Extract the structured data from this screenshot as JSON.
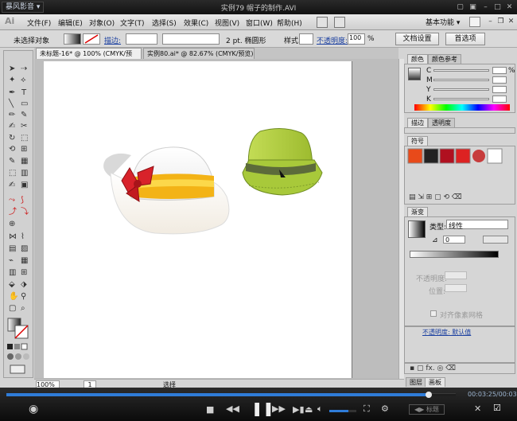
{
  "player": {
    "badge": "暴风影音",
    "window_title": "实例79 帽子的制作.AVI",
    "time": "00:03:25/00:03:38",
    "progress_fraction": 0.94,
    "volume_fraction": 0.7,
    "subtitle_label": "标题"
  },
  "ai": {
    "logo": "Ai",
    "menus": [
      "文件(F)",
      "编辑(E)",
      "对象(O)",
      "文字(T)",
      "选择(S)",
      "效果(C)",
      "视图(V)",
      "窗口(W)",
      "帮助(H)"
    ],
    "workspace": "基本功能"
  },
  "control": {
    "selection_label": "未选择对象",
    "stroke_label": "描边:",
    "brush_size": "2 pt. 椭圆形",
    "style_label": "样式:",
    "opacity_label": "不透明度:",
    "opacity_value": "100",
    "opacity_unit": "%",
    "doc_settings": "文档设置",
    "preferences": "首选项"
  },
  "tabs": [
    {
      "label": "未标题-16* @ 100% (CMYK/预览)"
    },
    {
      "label": "实例80.ai* @ 82.67% (CMYK/预览)"
    }
  ],
  "status": {
    "zoom": "100%",
    "page": "1",
    "mode": "选择"
  },
  "panels": {
    "color_tab": "颜色",
    "color_guide_tab": "颜色参考",
    "cmyk": [
      "C",
      "M",
      "Y",
      "K"
    ],
    "percent": "%",
    "stroke_tab": "描边",
    "transparency_tab": "透明度",
    "symbols_tab": "符号",
    "gradient_tab": "渐变",
    "type_label": "类型:",
    "type_value": "线性",
    "angle_value": "0",
    "opacity_label": "不透明度:",
    "location_label": "位置:",
    "align_pixel": "对齐像素网格",
    "appearance_row": "不透明度: 默认值",
    "layers_tab": "图层",
    "artboards_tab": "画板"
  },
  "colors": {
    "hat_white": "#f7f7f7",
    "band_yellow": "#f3b316",
    "bow_red": "#d8222a",
    "bucket_green": "#a8c93a",
    "bucket_band": "#5c6b3a",
    "seek_blue": "#2f7cd8"
  },
  "icons": {
    "play_pause": "pause-icon",
    "eye": "eye-icon"
  }
}
